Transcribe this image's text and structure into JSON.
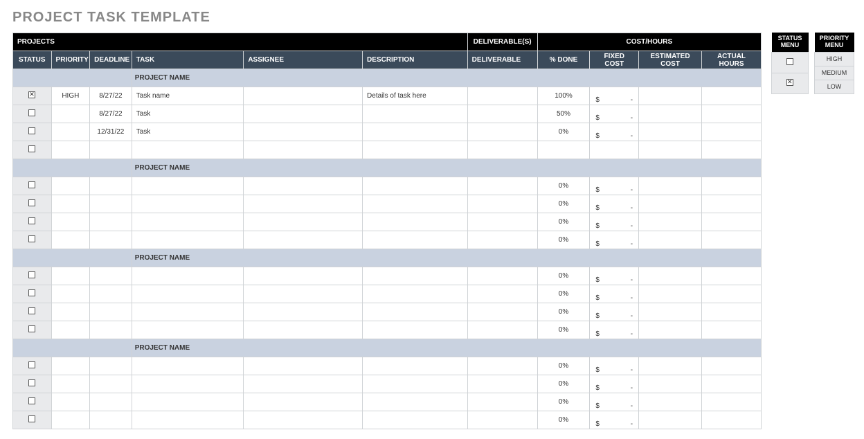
{
  "title": "PROJECT TASK TEMPLATE",
  "super_headers": {
    "projects": "PROJECTS",
    "deliverables": "DELIVERABLE(S)",
    "cost_hours": "COST/HOURS"
  },
  "headers": {
    "status": "STATUS",
    "priority": "PRIORITY",
    "deadline": "DEADLINE",
    "task": "TASK",
    "assignee": "ASSIGNEE",
    "description": "DESCRIPTION",
    "deliverable": "DELIVERABLE",
    "pct_done": "% DONE",
    "fixed_cost": "FIXED COST",
    "estimated_cost": "ESTIMATED COST",
    "actual_hours": "ACTUAL HOURS"
  },
  "sections": [
    {
      "name": "PROJECT NAME",
      "rows": [
        {
          "checked": true,
          "priority": "HIGH",
          "deadline": "8/27/22",
          "task": "Task name",
          "assignee": "",
          "description": "Details of task here",
          "deliverable": "",
          "pct_done": "100%",
          "fixed_sym": "$",
          "fixed_dash": "-",
          "est": "",
          "actual": ""
        },
        {
          "checked": false,
          "priority": "",
          "deadline": "8/27/22",
          "task": "Task",
          "assignee": "",
          "description": "",
          "deliverable": "",
          "pct_done": "50%",
          "fixed_sym": "$",
          "fixed_dash": "-",
          "est": "",
          "actual": ""
        },
        {
          "checked": false,
          "priority": "",
          "deadline": "12/31/22",
          "task": "Task",
          "assignee": "",
          "description": "",
          "deliverable": "",
          "pct_done": "0%",
          "fixed_sym": "$",
          "fixed_dash": "-",
          "est": "",
          "actual": ""
        },
        {
          "checked": false,
          "priority": "",
          "deadline": "",
          "task": "",
          "assignee": "",
          "description": "",
          "deliverable": "",
          "pct_done": "",
          "fixed_sym": "",
          "fixed_dash": "",
          "est": "",
          "actual": ""
        }
      ]
    },
    {
      "name": "PROJECT NAME",
      "rows": [
        {
          "checked": false,
          "priority": "",
          "deadline": "",
          "task": "",
          "assignee": "",
          "description": "",
          "deliverable": "",
          "pct_done": "0%",
          "fixed_sym": "$",
          "fixed_dash": "-",
          "est": "",
          "actual": ""
        },
        {
          "checked": false,
          "priority": "",
          "deadline": "",
          "task": "",
          "assignee": "",
          "description": "",
          "deliverable": "",
          "pct_done": "0%",
          "fixed_sym": "$",
          "fixed_dash": "-",
          "est": "",
          "actual": ""
        },
        {
          "checked": false,
          "priority": "",
          "deadline": "",
          "task": "",
          "assignee": "",
          "description": "",
          "deliverable": "",
          "pct_done": "0%",
          "fixed_sym": "$",
          "fixed_dash": "-",
          "est": "",
          "actual": ""
        },
        {
          "checked": false,
          "priority": "",
          "deadline": "",
          "task": "",
          "assignee": "",
          "description": "",
          "deliverable": "",
          "pct_done": "0%",
          "fixed_sym": "$",
          "fixed_dash": "-",
          "est": "",
          "actual": ""
        }
      ]
    },
    {
      "name": "PROJECT NAME",
      "rows": [
        {
          "checked": false,
          "priority": "",
          "deadline": "",
          "task": "",
          "assignee": "",
          "description": "",
          "deliverable": "",
          "pct_done": "0%",
          "fixed_sym": "$",
          "fixed_dash": "-",
          "est": "",
          "actual": ""
        },
        {
          "checked": false,
          "priority": "",
          "deadline": "",
          "task": "",
          "assignee": "",
          "description": "",
          "deliverable": "",
          "pct_done": "0%",
          "fixed_sym": "$",
          "fixed_dash": "-",
          "est": "",
          "actual": ""
        },
        {
          "checked": false,
          "priority": "",
          "deadline": "",
          "task": "",
          "assignee": "",
          "description": "",
          "deliverable": "",
          "pct_done": "0%",
          "fixed_sym": "$",
          "fixed_dash": "-",
          "est": "",
          "actual": ""
        },
        {
          "checked": false,
          "priority": "",
          "deadline": "",
          "task": "",
          "assignee": "",
          "description": "",
          "deliverable": "",
          "pct_done": "0%",
          "fixed_sym": "$",
          "fixed_dash": "-",
          "est": "",
          "actual": ""
        }
      ]
    },
    {
      "name": "PROJECT NAME",
      "rows": [
        {
          "checked": false,
          "priority": "",
          "deadline": "",
          "task": "",
          "assignee": "",
          "description": "",
          "deliverable": "",
          "pct_done": "0%",
          "fixed_sym": "$",
          "fixed_dash": "-",
          "est": "",
          "actual": ""
        },
        {
          "checked": false,
          "priority": "",
          "deadline": "",
          "task": "",
          "assignee": "",
          "description": "",
          "deliverable": "",
          "pct_done": "0%",
          "fixed_sym": "$",
          "fixed_dash": "-",
          "est": "",
          "actual": ""
        },
        {
          "checked": false,
          "priority": "",
          "deadline": "",
          "task": "",
          "assignee": "",
          "description": "",
          "deliverable": "",
          "pct_done": "0%",
          "fixed_sym": "$",
          "fixed_dash": "-",
          "est": "",
          "actual": ""
        },
        {
          "checked": false,
          "priority": "",
          "deadline": "",
          "task": "",
          "assignee": "",
          "description": "",
          "deliverable": "",
          "pct_done": "0%",
          "fixed_sym": "$",
          "fixed_dash": "-",
          "est": "",
          "actual": ""
        }
      ]
    }
  ],
  "status_menu": {
    "title": "STATUS MENU",
    "options": [
      {
        "checked": false
      },
      {
        "checked": true
      }
    ]
  },
  "priority_menu": {
    "title": "PRIORITY MENU",
    "options": [
      "HIGH",
      "MEDIUM",
      "LOW"
    ]
  }
}
